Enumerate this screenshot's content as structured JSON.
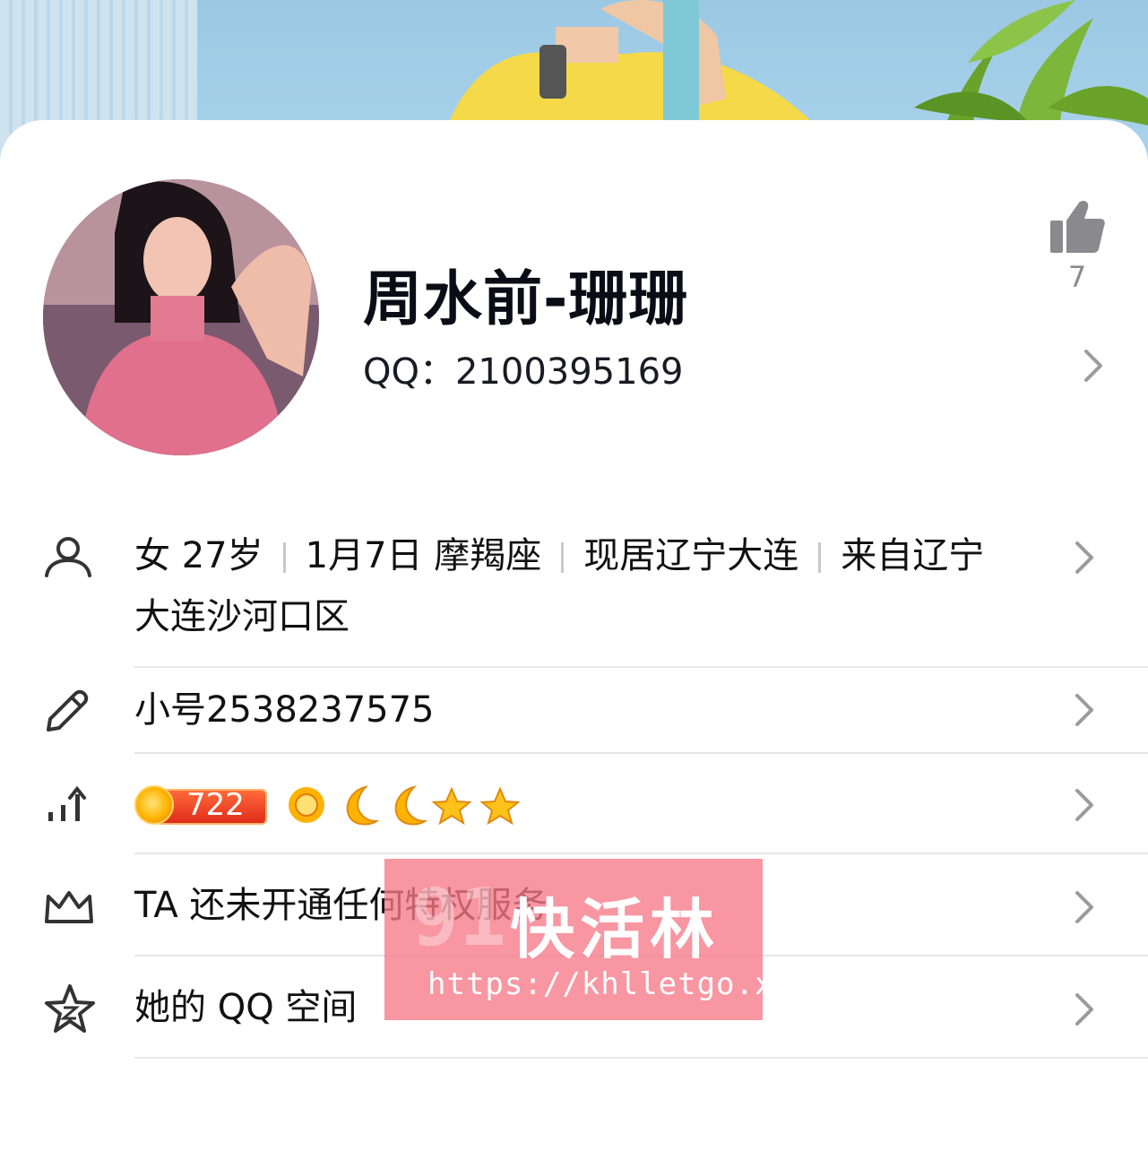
{
  "profile": {
    "name": "周水前-珊珊",
    "qq_label": "QQ：",
    "qq_number": "2100395169",
    "like_count": "7"
  },
  "info": {
    "gender": "女",
    "age": "27岁",
    "birthday": "1月7日 摩羯座",
    "residence": "现居辽宁大连",
    "hometown_line1": "来自辽宁",
    "hometown_line2": "大连沙河口区"
  },
  "alt_account": {
    "label": "小号",
    "number": "2538237575"
  },
  "level": {
    "value": "722",
    "icons": [
      "sun-icon",
      "moon-icon",
      "moon-icon",
      "star-icon",
      "star-icon"
    ]
  },
  "privilege": {
    "text": "TA 还未开通任何特权服务"
  },
  "qzone": {
    "text": "她的 QQ 空间"
  },
  "watermark": {
    "num": "91",
    "title": "快活林",
    "url": "https://khlletgo.xyz"
  },
  "colors": {
    "primary_text": "#111111",
    "secondary_text": "#8a8a8e",
    "divider": "#e6e6ea",
    "watermark_bg": "#f67888",
    "level_badge": "#e02c1a"
  }
}
